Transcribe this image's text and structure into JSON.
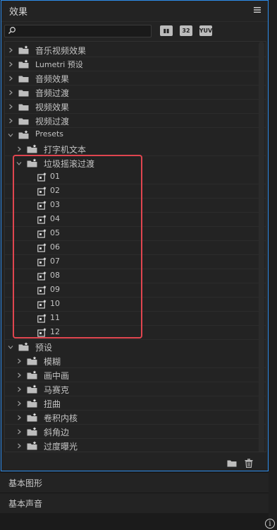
{
  "panel": {
    "title": "效果"
  },
  "toolbar": {
    "btn1": "▮▮",
    "btn2": "32",
    "btn3": "YUV"
  },
  "tree": {
    "top": [
      {
        "label": "音乐视频效果",
        "kind": "preset-folder"
      },
      {
        "label": "Lumetri 预设",
        "kind": "preset-folder"
      },
      {
        "label": "音频效果",
        "kind": "folder"
      },
      {
        "label": "音频过渡",
        "kind": "folder"
      },
      {
        "label": "视频效果",
        "kind": "folder"
      },
      {
        "label": "视频过渡",
        "kind": "folder"
      }
    ],
    "presets": "Presets",
    "typewriter": "打字机文本",
    "glitch": "垃圾摇滚过渡",
    "glitch_items": [
      "01",
      "02",
      "03",
      "04",
      "05",
      "06",
      "07",
      "08",
      "09",
      "10",
      "11",
      "12"
    ],
    "yushe": "预设",
    "yushe_items": [
      "模糊",
      "画中画",
      "马赛克",
      "扭曲",
      "卷积内核",
      "斜角边",
      "过度曝光"
    ]
  },
  "sections": {
    "graphics": "基本图形",
    "audio": "基本声音"
  },
  "info": "i"
}
